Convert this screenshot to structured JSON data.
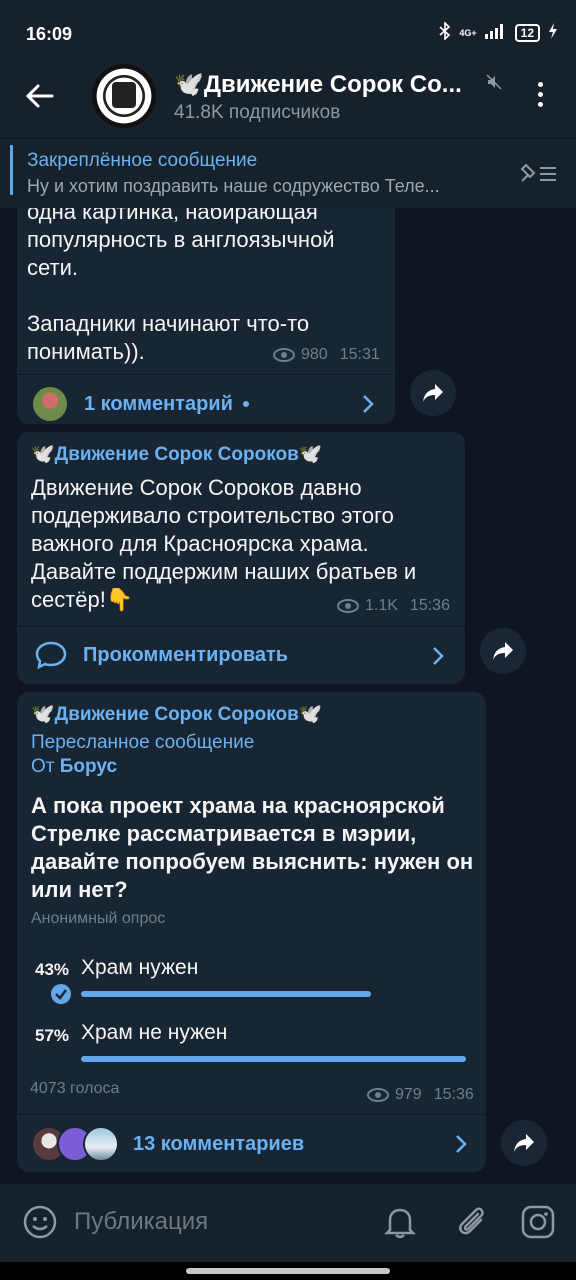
{
  "status_bar": {
    "time": "16:09",
    "battery": "12",
    "network": "4G+"
  },
  "header": {
    "title": "🕊️Движение Сорок Со...",
    "subtitle": "41.8K подписчиков"
  },
  "pinned": {
    "title": "Закреплённое сообщение",
    "text": "Ну и хотим поздравить наше содружество Теле..."
  },
  "messages": [
    {
      "text_lines": [
        "одна картинка, набирающая",
        "популярность в англоязычной",
        "сети.",
        "",
        "Западники начинают что-то",
        "понимать))."
      ],
      "views": "980",
      "time": "15:31",
      "comments_label": "1 комментарий"
    },
    {
      "sender": "🕊️Движение Сорок Сороков🕊️",
      "text": "Движение Сорок Сороков давно поддерживало строительство этого важного для Красноярска храма. Давайте поддержим наших братьев и сестёр!👇",
      "views": "1.1K",
      "time": "15:36",
      "comments_label": "Прокомментировать"
    },
    {
      "sender": "🕊️Движение Сорок Сороков🕊️",
      "forwarded_label": "Пересланное сообщение",
      "forwarded_from_prefix": "От",
      "forwarded_from": "Борус",
      "poll_question": "А пока проект храма на красноярской Стрелке рассматривается в мэрии, давайте попробуем выяснить: нужен он или нет?",
      "poll_type": "Анонимный опрос",
      "options": [
        {
          "percent": "43%",
          "label": "Храм нужен",
          "value": 43,
          "chosen": true
        },
        {
          "percent": "57%",
          "label": "Храм не нужен",
          "value": 57,
          "chosen": false
        }
      ],
      "votes": "4073 голоса",
      "views": "979",
      "time": "15:36",
      "comments_label": "13 комментариев"
    }
  ],
  "composer": {
    "placeholder": "Публикация"
  },
  "colors": {
    "accent": "#6ab2f2",
    "bubble": "#182533",
    "background": "#0e1621"
  }
}
